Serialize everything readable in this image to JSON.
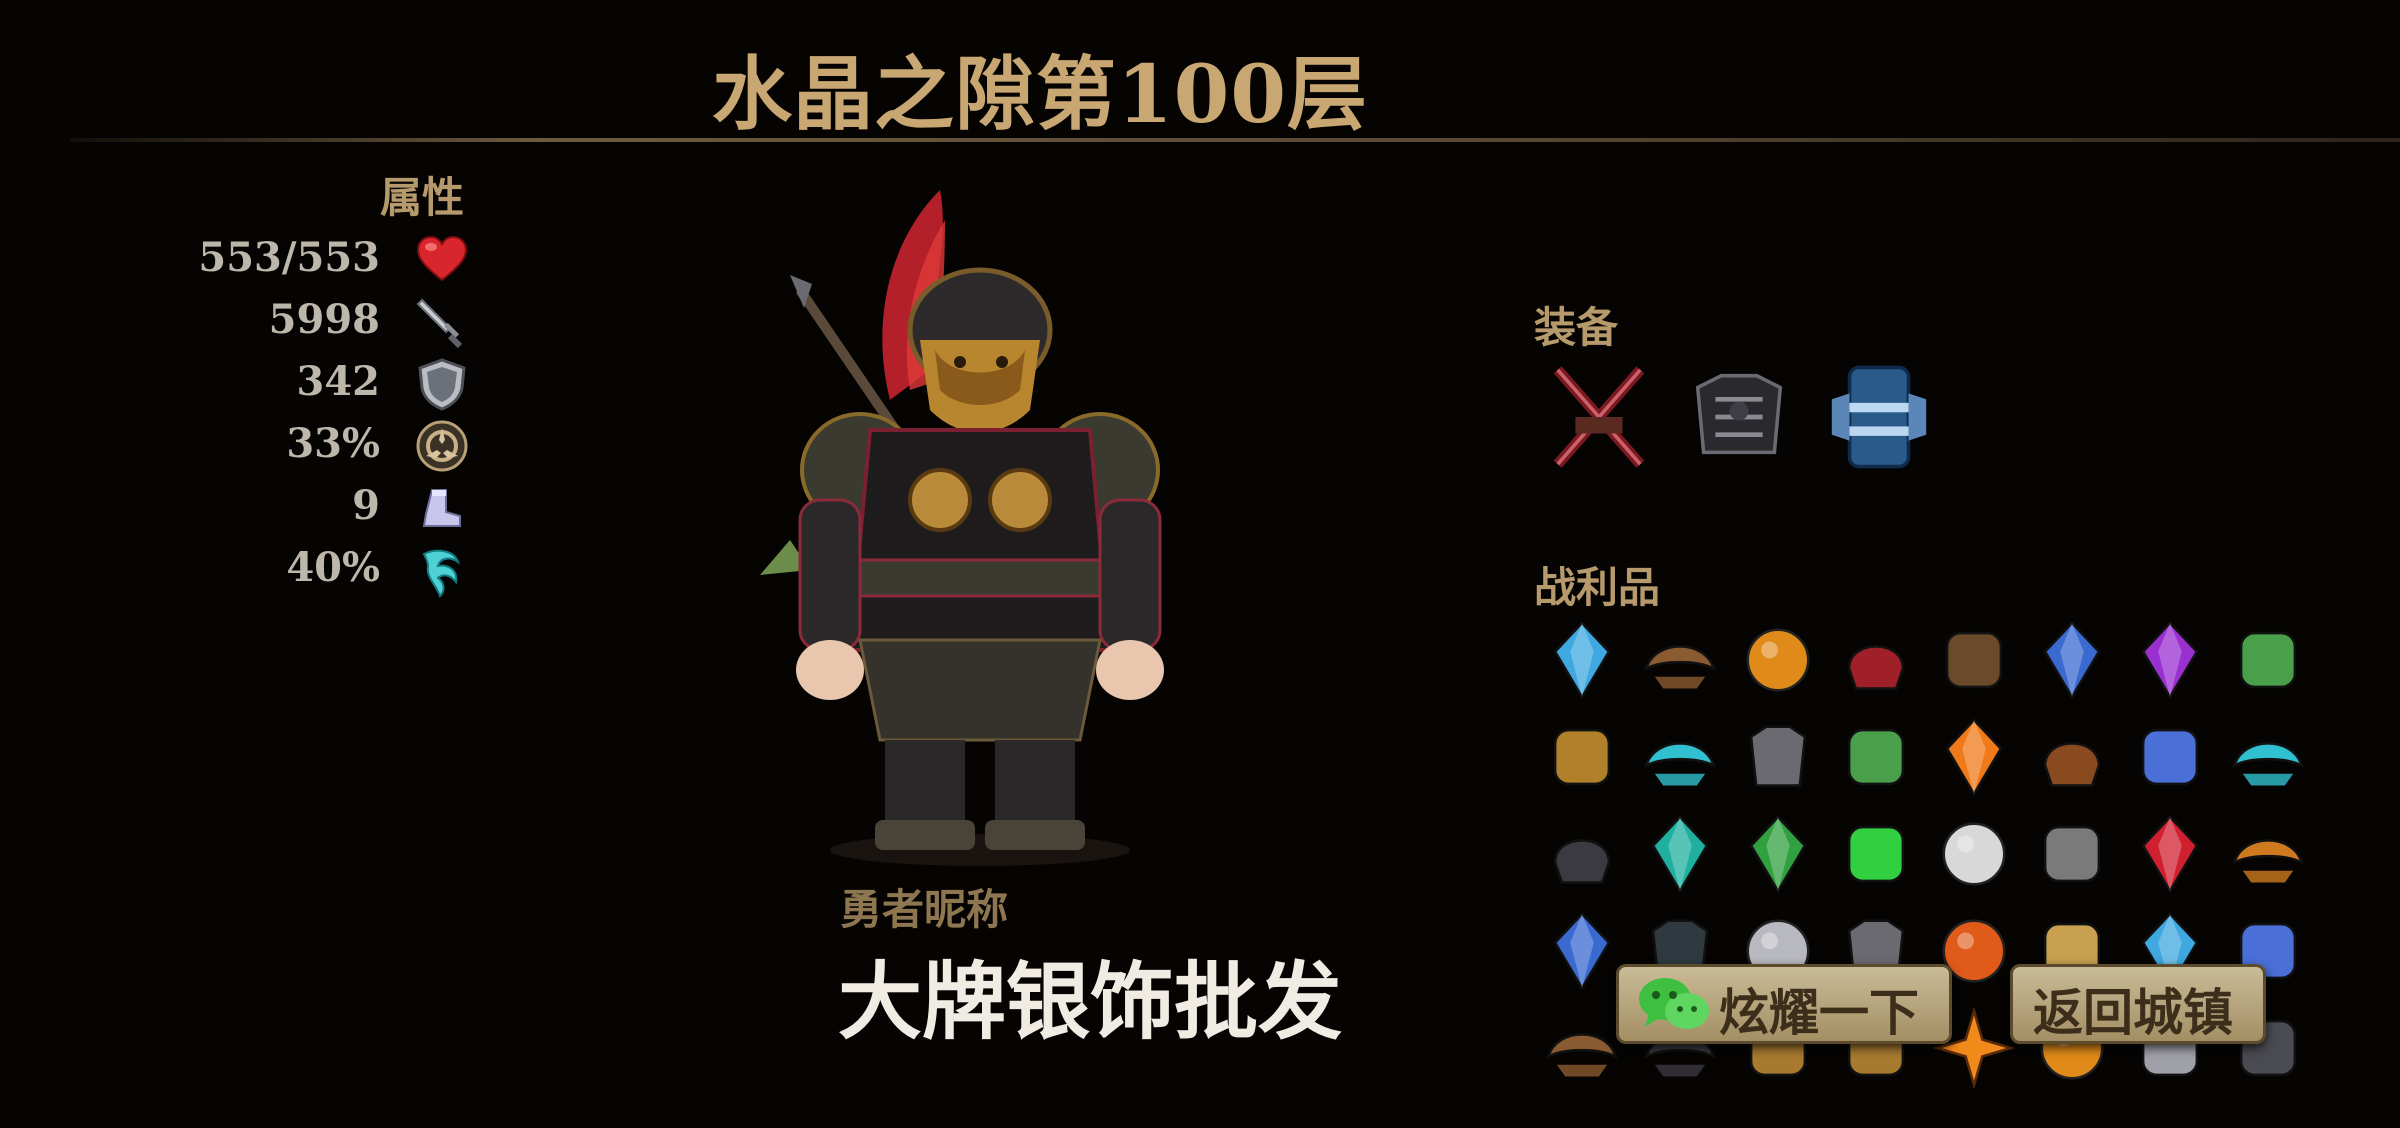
{
  "header": {
    "title": "水晶之隙第100层"
  },
  "stats": {
    "label": "属性",
    "items": [
      {
        "value": "553/553",
        "icon": "heart-icon"
      },
      {
        "value": "5998",
        "icon": "sword-icon"
      },
      {
        "value": "342",
        "icon": "shield-icon"
      },
      {
        "value": "33%",
        "icon": "critical-emblem-icon"
      },
      {
        "value": "9",
        "icon": "boot-icon"
      },
      {
        "value": "40%",
        "icon": "dodge-swirl-icon"
      }
    ]
  },
  "hero": {
    "nickname_label": "勇者昵称",
    "nickname": "大牌银饰批发"
  },
  "equipment": {
    "label": "装备",
    "items": [
      "crossed-swords-icon",
      "dark-chest-armor-icon",
      "blue-bracer-icon"
    ]
  },
  "loot": {
    "label": "战利品",
    "items": [
      "blue-crystal-icon",
      "brown-pauldron-icon",
      "fire-orb-icon",
      "red-mask-icon",
      "spiked-collar-icon",
      "blue-shield-gem-icon",
      "purple-crystal-icon",
      "green-ore-icon",
      "gold-pouch-icon",
      "cyan-pauldron-icon",
      "grey-armor-icon",
      "green-ore-icon",
      "orange-crystal-icon",
      "brown-helmet-icon",
      "blue-glove-icon",
      "cyan-pauldron-icon",
      "dark-helmet-icon",
      "teal-crystal-icon",
      "green-gem-icon",
      "green-flame-icon",
      "white-orb-icon",
      "grey-stone-icon",
      "red-crystal-icon",
      "orange-pauldron-icon",
      "blue-shield-gem-icon",
      "dark-armor-icon",
      "silver-ring-icon",
      "grey-armor-icon",
      "fire-ring-icon",
      "gold-scroll-icon",
      "blue-crystal-icon",
      "blue-glove-icon",
      "brown-pauldron-icon",
      "dark-pauldron-icon",
      "gold-boot-icon",
      "gold-boot-icon",
      "orange-star-icon",
      "fire-orb-icon",
      "silver-necklace-icon",
      "dark-hammer-icon"
    ]
  },
  "buttons": {
    "share_label": "炫耀一下",
    "return_label": "返回城镇"
  },
  "colors": {
    "title": "#c8a772",
    "section_label": "#b79a6c",
    "stat_value": "#bdb6aa",
    "button_bg": "#b9a77f",
    "button_text": "#3c2e1b",
    "background": "#050403"
  }
}
